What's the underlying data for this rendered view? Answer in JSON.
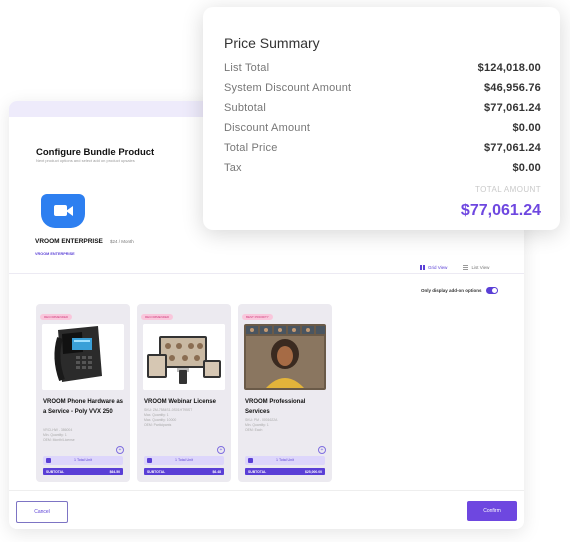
{
  "configure": {
    "title": "Configure Bundle Product",
    "subtitle": "Next product options and select add on product upsales",
    "product_name": "VROOM ENTERPRISE",
    "product_price": "$24 / Month",
    "product_link": "VROOM ENTERPRISE",
    "grid_view_label": "Grid View",
    "list_view_label": "List View",
    "only_addon_label": "Only display add-on options",
    "only_addon_enabled": true,
    "cards": [
      {
        "tag": "RECOMMENDED",
        "name": "VROOM Phone Hardware as a Service - Poly VVX 250",
        "meta": [
          "VRCI-HW - 386004",
          "Min. Quantity: 1",
          "OEM: Month/License"
        ],
        "unit_label": "1 Total Unit",
        "subtotal_label": "SUBTOTAL",
        "subtotal_value": "$64.50"
      },
      {
        "tag": "RECOMMENDED",
        "name": "VROOM Webinar License",
        "meta": [
          "SKU: ZM-7584S1-0S01HT95ST",
          "Max. Quantity: 1",
          "Max. Quantity: 10000",
          "OEM: Participants"
        ],
        "unit_label": "1 Total Unit",
        "subtotal_label": "SUBTOTAL",
        "subtotal_value": "$6.48"
      },
      {
        "tag": "BEST PRIORITY",
        "name": "VROOM Professional Services",
        "meta": [
          "SKU: PM - 0001622A",
          "Min. Quantity: 1",
          "OEM: Each"
        ],
        "unit_label": "1 Total Unit",
        "subtotal_label": "SUBTOTAL",
        "subtotal_value": "$25,000.00"
      }
    ],
    "cancel_label": "Cancel",
    "confirm_label": "Confirm"
  },
  "price_summary": {
    "title": "Price Summary",
    "rows": [
      {
        "label": "List Total",
        "value": "$124,018.00"
      },
      {
        "label": "System Discount Amount",
        "value": "$46,956.76"
      },
      {
        "label": "Subtotal",
        "value": "$77,061.24"
      },
      {
        "label": "Discount Amount",
        "value": "$0.00"
      },
      {
        "label": "Total Price",
        "value": "$77,061.24"
      },
      {
        "label": "Tax",
        "value": "$0.00"
      }
    ],
    "total_label": "TOTAL AMOUNT",
    "total_value": "$77,061.24"
  },
  "colors": {
    "accent": "#6e47e0",
    "brand_icon": "#2d7ff0",
    "tag_pink": "#f9c7dc"
  }
}
